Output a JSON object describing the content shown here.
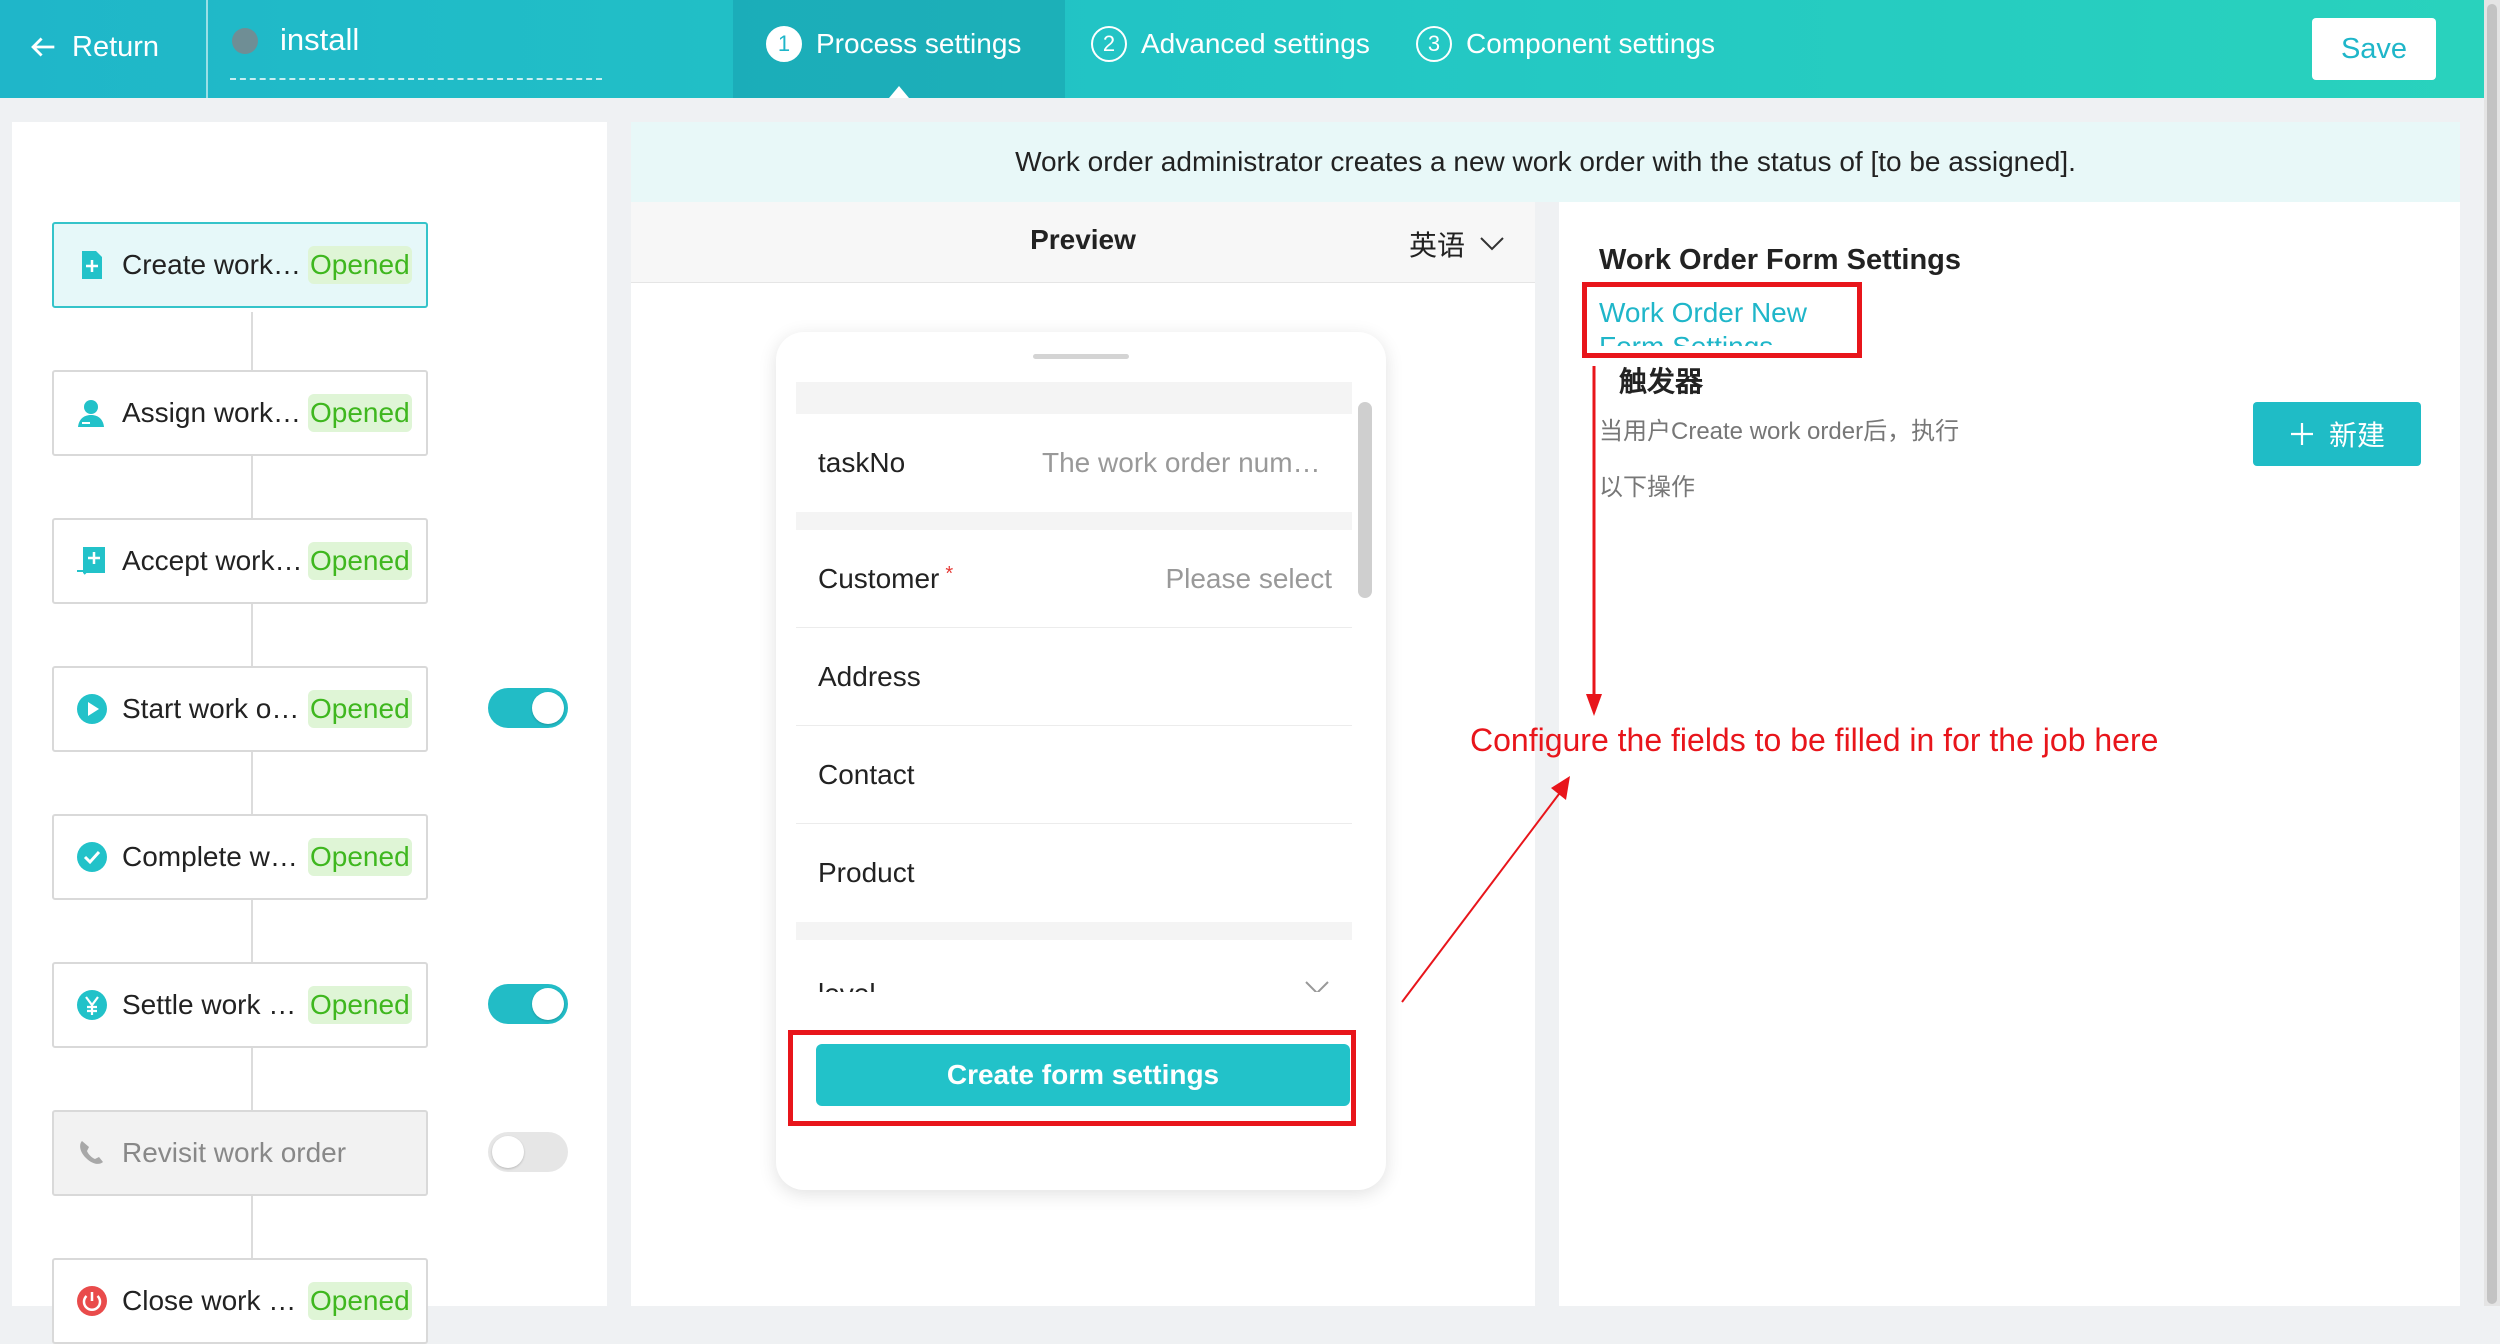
{
  "header": {
    "return_label": "Return",
    "app_name": "install",
    "steps": [
      {
        "num": "1",
        "label": "Process settings"
      },
      {
        "num": "2",
        "label": "Advanced settings"
      },
      {
        "num": "3",
        "label": "Component settings"
      }
    ],
    "save_label": "Save"
  },
  "process": {
    "nodes": [
      {
        "label": "Create work order",
        "status": "Opened",
        "icon": "file-plus-icon"
      },
      {
        "label": "Assign work order",
        "status": "Opened",
        "icon": "user-assign-icon"
      },
      {
        "label": "Accept work order",
        "status": "Opened",
        "icon": "accept-icon"
      },
      {
        "label": "Start work order",
        "status": "Opened",
        "icon": "play-icon",
        "toggle": true
      },
      {
        "label": "Complete work order",
        "status": "Opened",
        "icon": "check-circle-icon"
      },
      {
        "label": "Settle work order",
        "status": "Opened",
        "icon": "yen-icon",
        "toggle": true
      },
      {
        "label": "Revisit work order",
        "status": "",
        "icon": "phone-icon",
        "toggle": false
      },
      {
        "label": "Close work order",
        "status": "Opened",
        "icon": "power-icon"
      }
    ]
  },
  "banner": "Work order administrator creates a new work order with the status of [to be assigned].",
  "preview": {
    "title": "Preview",
    "language": "英语",
    "fields": [
      {
        "label": "taskNo",
        "placeholder": "The work order number is automatically generated"
      },
      {
        "label": "Customer",
        "placeholder": "Please select",
        "required": "*"
      },
      {
        "label": "Address",
        "placeholder": ""
      },
      {
        "label": "Contact",
        "placeholder": ""
      },
      {
        "label": "Product",
        "placeholder": ""
      },
      {
        "label": "level",
        "placeholder": ""
      }
    ],
    "create_button": "Create form settings"
  },
  "settings": {
    "form_title": "Work Order Form Settings",
    "form_link": "Work Order New Form Settings",
    "trigger_title": "触发器",
    "trigger_desc": "当用户Create work order后，执行以下操作",
    "new_button": "新建"
  },
  "annotation": "Configure the fields to be filled in for the job here",
  "colors": {
    "accent": "#22c2c9",
    "highlight": "#e8151b",
    "status_green": "#3fb71f"
  }
}
